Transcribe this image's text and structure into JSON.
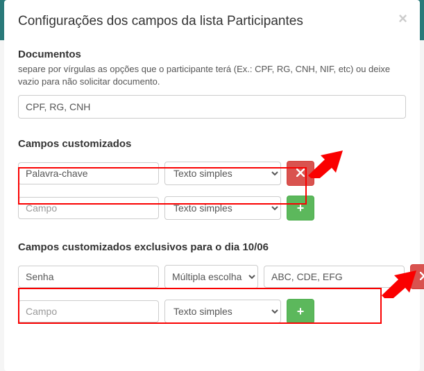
{
  "modal": {
    "title": "Configurações dos campos da lista Participantes",
    "close": "×"
  },
  "documents": {
    "title": "Documentos",
    "hint": "separe por vírgulas as opções que o participante terá (Ex.: CPF, RG, CNH, NIF, etc) ou deixe vazio para não solicitar documento.",
    "value": "CPF, RG, CNH"
  },
  "custom_fields": {
    "title": "Campos customizados",
    "rows": [
      {
        "name": "Palavra-chave",
        "type": "Texto simples",
        "action": "remove"
      },
      {
        "name": "",
        "placeholder": "Campo",
        "type": "Texto simples",
        "action": "add"
      }
    ]
  },
  "exclusive_fields": {
    "title": "Campos customizados exclusivos para o dia 10/06",
    "rows": [
      {
        "name": "Senha",
        "type": "Múltipla escolha",
        "options": "ABC, CDE, EFG",
        "action": "remove"
      },
      {
        "name": "",
        "placeholder": "Campo",
        "type": "Texto simples",
        "action": "add"
      }
    ]
  },
  "icons": {
    "plus": "+"
  }
}
